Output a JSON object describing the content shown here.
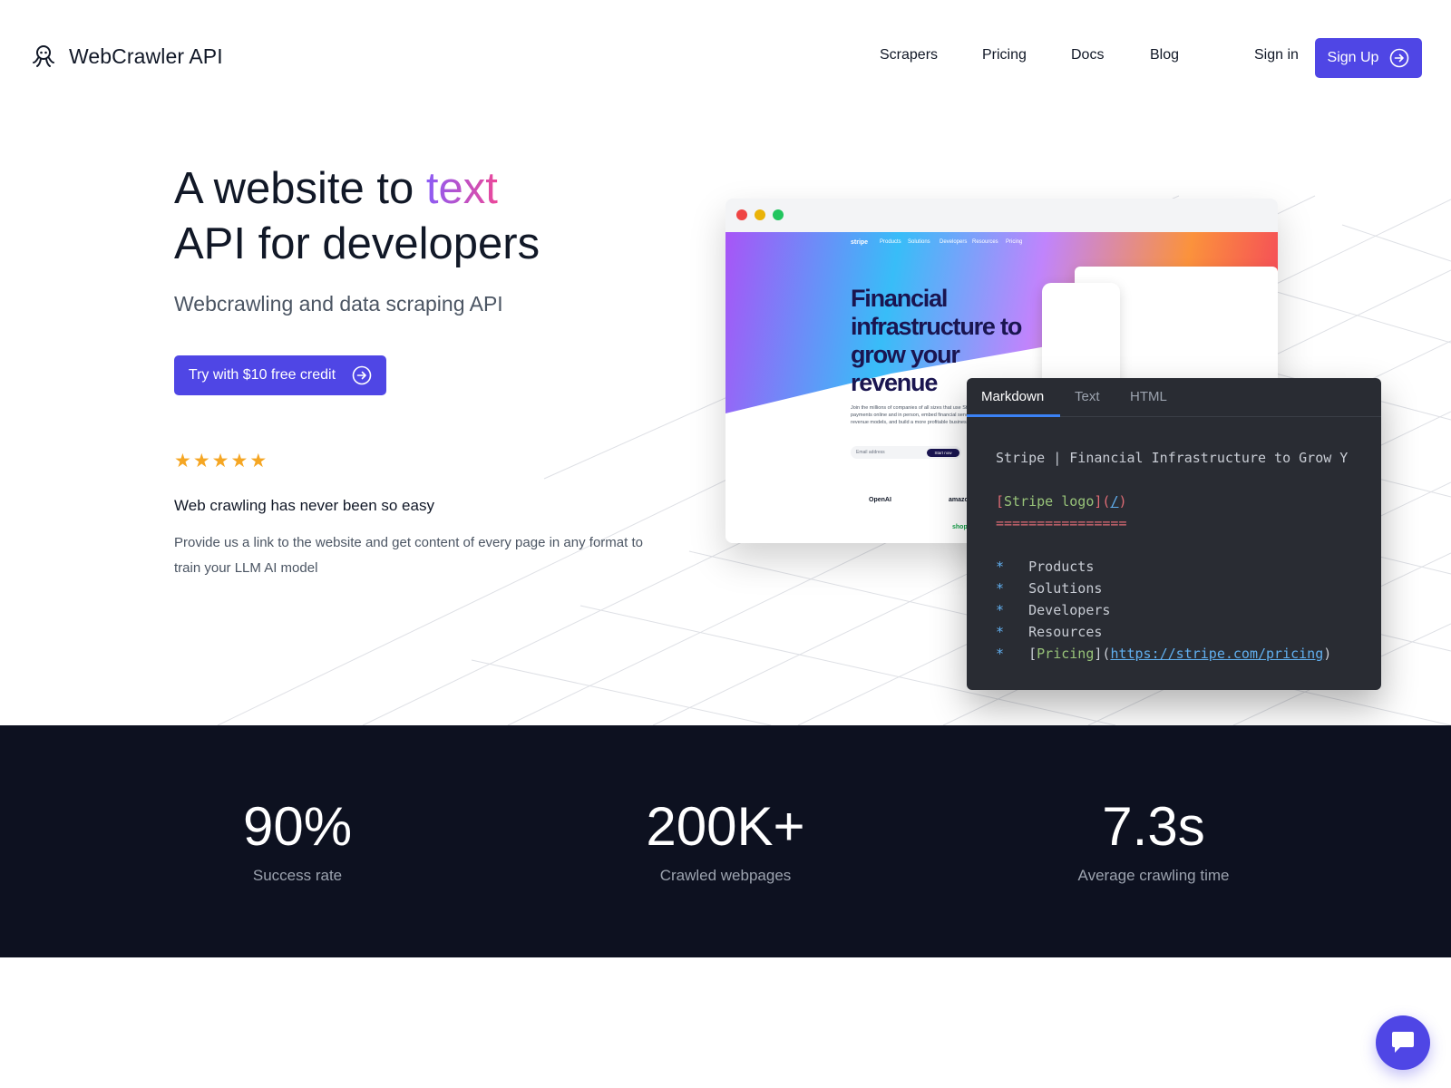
{
  "brand": {
    "name": "WebCrawler API",
    "accent": "#4f46e5"
  },
  "nav": {
    "items": [
      "Scrapers",
      "Pricing",
      "Docs",
      "Blog"
    ],
    "sign_in": "Sign in",
    "sign_up": "Sign Up"
  },
  "hero": {
    "title_part1": "A website to ",
    "title_highlight": "text",
    "title_part2": "API for developers",
    "subtitle": "Webcrawling and data scraping API",
    "cta": "Try with $10 free credit",
    "rating_stars": 5,
    "tagline": "Web crawling has never been so easy",
    "description": "Provide us a link to the website and get content of every page in any format to train your LLM AI model"
  },
  "preview": {
    "site_nav": [
      "stripe",
      "Products",
      "Solutions",
      "Developers",
      "Resources",
      "Pricing"
    ],
    "site_heading": "Financial infrastructure to grow your revenue",
    "site_body": "Join the millions of companies of all sizes that use Stripe to accept payments online and in person, embed financial services, power custom revenue models, and build a more profitable business.",
    "email_placeholder": "Email address",
    "start_button": "Start now",
    "logos": [
      "OpenAI",
      "amazon",
      "shopify"
    ]
  },
  "code_panel": {
    "tabs": [
      "Markdown",
      "Text",
      "HTML"
    ],
    "active_tab": "Markdown",
    "lines": {
      "title": "Stripe | Financial Infrastructure to Grow Y",
      "logo_text": "Stripe logo",
      "logo_link": "/",
      "underline": "================",
      "items": [
        "Products",
        "Solutions",
        "Developers",
        "Resources"
      ],
      "pricing_text": "Pricing",
      "pricing_url": "https://stripe.com/pricing"
    }
  },
  "stats": [
    {
      "value": "90%",
      "label": "Success rate"
    },
    {
      "value": "200K+",
      "label": "Crawled webpages"
    },
    {
      "value": "7.3s",
      "label": "Average crawling time"
    }
  ]
}
